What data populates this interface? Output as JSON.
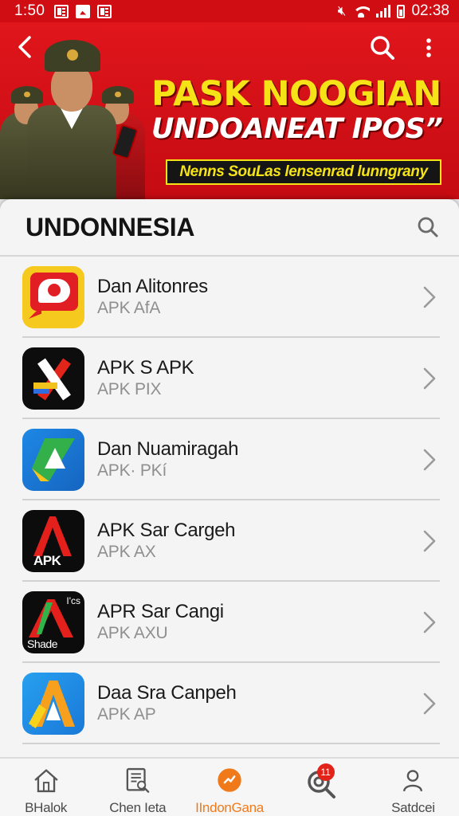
{
  "status_bar": {
    "time": "1:50",
    "clock_right": "02:38"
  },
  "banner": {
    "title": "PASK NOOGIAN",
    "subtitle": "UNDOANEAT IPOS”",
    "tagline": "Nenns SouLas lensenrad lunngrany"
  },
  "section": {
    "title": "UNDONNESIA"
  },
  "apps": [
    {
      "name": "Dan Alitonres",
      "sub": "APK AfA"
    },
    {
      "name": "APK S APK",
      "sub": "APK PIX"
    },
    {
      "name": "Dan Nuamiragah",
      "sub": "APK· PKí"
    },
    {
      "name": "APK Sar Cargeh",
      "sub": "APK AX",
      "icon_label": "APK"
    },
    {
      "name": "APR Sar Cangi",
      "sub": "APK AXU",
      "icon_label_top": "I'cs",
      "icon_label_bottom": "Shade"
    },
    {
      "name": "Daa Sra Canpeh",
      "sub": "APK AP"
    }
  ],
  "nav": {
    "items": [
      {
        "label": "BHalok",
        "icon": "home-icon"
      },
      {
        "label": "Chen Ieta",
        "icon": "document-search-icon"
      },
      {
        "label": "IIndonGana",
        "icon": "bolt-circle-icon",
        "active": true
      },
      {
        "label": "",
        "icon": "search-badge-icon",
        "badge": "11"
      },
      {
        "label": "Satdcei",
        "icon": "profile-icon"
      }
    ]
  },
  "colors": {
    "brand_red": "#d10d14",
    "banner_yellow": "#f6e317",
    "active_orange": "#f07a1a"
  }
}
